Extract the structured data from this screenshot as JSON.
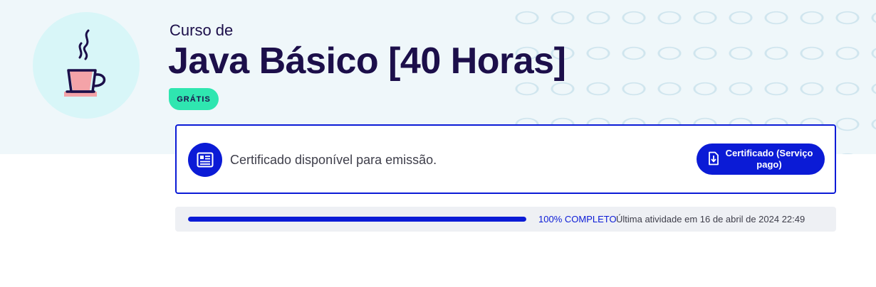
{
  "course": {
    "prefix": "Curso de",
    "title": "Java Básico [40 Horas]",
    "price_badge": "GRÁTIS",
    "icon": "coffee-cup-icon"
  },
  "certificate": {
    "message": "Certificado disponível para emissão.",
    "button_label": "Certificado (Serviço pago)",
    "icon": "certificate-icon",
    "button_icon": "download-file-icon"
  },
  "progress": {
    "percent_value": 100,
    "percent_label": "100% COMPLETO",
    "last_activity": "Última atividade em 16 de abril de 2024 22:49"
  },
  "colors": {
    "primary": "#0b1bd6",
    "title": "#1c0f4a",
    "badge": "#2fe6b0",
    "hero_background": "#eff7fa",
    "icon_circle": "#d8f6f8",
    "cup_accent": "#f4a3a8"
  }
}
